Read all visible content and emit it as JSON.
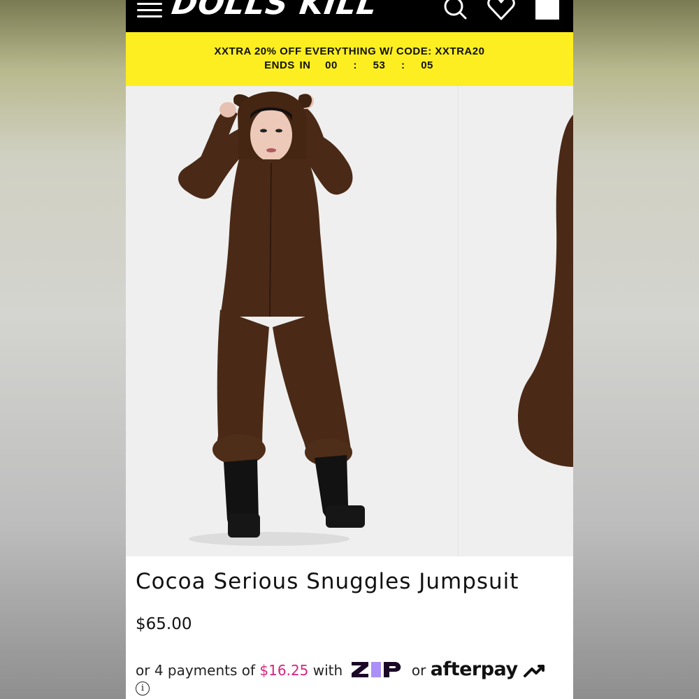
{
  "header": {
    "logo_text": "DOLLS KILL",
    "icons": [
      "menu-icon",
      "search-icon",
      "heart-icon",
      "bag-icon"
    ]
  },
  "promo": {
    "line1": "XXTRA 20% OFF EVERYTHING W/ CODE: XXTRA20",
    "ends_label": "ENDS IN",
    "hours": "00",
    "minutes": "53",
    "seconds": "05",
    "separator": ":",
    "background": "#fcee21"
  },
  "product": {
    "title": "Cocoa Serious Snuggles Jumpsuit",
    "price": "$65.00",
    "payments_prefix": "or 4 payments of",
    "installment": "$16.25",
    "payments_with": "with",
    "zip_label": "zip",
    "payments_or": "or",
    "afterpay_label": "afterpay",
    "info_symbol": "i",
    "installment_color": "#d6247f"
  },
  "colors": {
    "header_bg": "#000000",
    "jumpsuit_brown": "#4a2a17",
    "zip_purple": "#aa8ff7"
  }
}
